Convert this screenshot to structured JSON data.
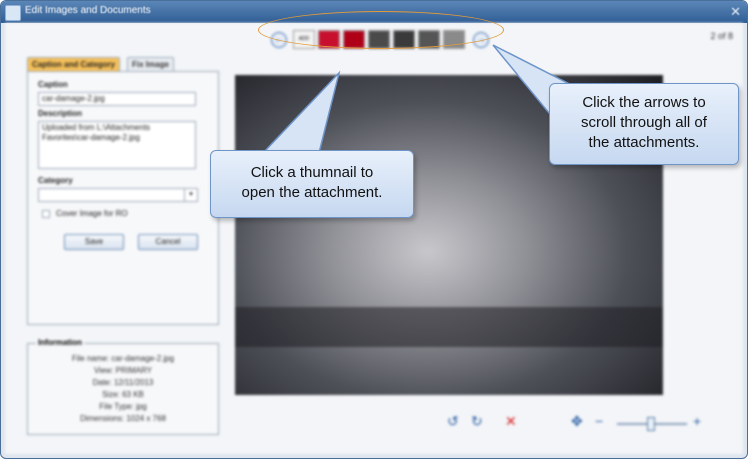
{
  "window": {
    "title": "Edit Images and Documents",
    "close_glyph": "✕"
  },
  "counter": "2 of 8",
  "nav": {
    "prev_glyph": "←",
    "next_glyph": "→"
  },
  "thumbnails": [
    {
      "label": "thumbnail-1",
      "color": "#f4f4f4",
      "text": "ADD"
    },
    {
      "label": "thumbnail-2",
      "color": "#c8102e",
      "text": ""
    },
    {
      "label": "thumbnail-3",
      "color": "#b00018",
      "text": ""
    },
    {
      "label": "thumbnail-4",
      "color": "#4a4a4a",
      "text": ""
    },
    {
      "label": "thumbnail-5",
      "color": "#3a3a3a",
      "text": ""
    },
    {
      "label": "thumbnail-6",
      "color": "#555555",
      "text": ""
    },
    {
      "label": "thumbnail-7",
      "color": "#8a8a8a",
      "text": ""
    }
  ],
  "tabs": {
    "caption_category": "Caption and Category",
    "fix_image": "Fix Image"
  },
  "form": {
    "caption_label": "Caption",
    "caption_value": "car-damage-2.jpg",
    "description_label": "Description",
    "description_value": "Uploaded from L:\\Attachments Favorites\\car-damage-2.jpg",
    "category_label": "Category",
    "category_value": "",
    "cover_label": "Cover Image for RO",
    "save": "Save",
    "cancel": "Cancel"
  },
  "info": {
    "legend": "Information",
    "rows": [
      "File name: car-damage-2.jpg",
      "View: PRIMARY",
      "Date: 12/11/2013",
      "Size: 63 KB",
      "File Type: jpg",
      "Dimensions: 1024 x 768"
    ]
  },
  "toolbar": {
    "rotate_left": "↺",
    "rotate_right": "↻",
    "delete": "✕",
    "pan": "✥",
    "zoom_out": "−",
    "zoom_in": "+"
  },
  "callouts": {
    "thumbnail": [
      "Click a thumnail to",
      "open the attachment."
    ],
    "arrows": [
      "Click the arrows to",
      "scroll through all of",
      "the attachments."
    ]
  },
  "colors": {
    "accent": "#e39b3a",
    "delete_red": "#d42020",
    "nav_blue": "#2b5ea2"
  }
}
